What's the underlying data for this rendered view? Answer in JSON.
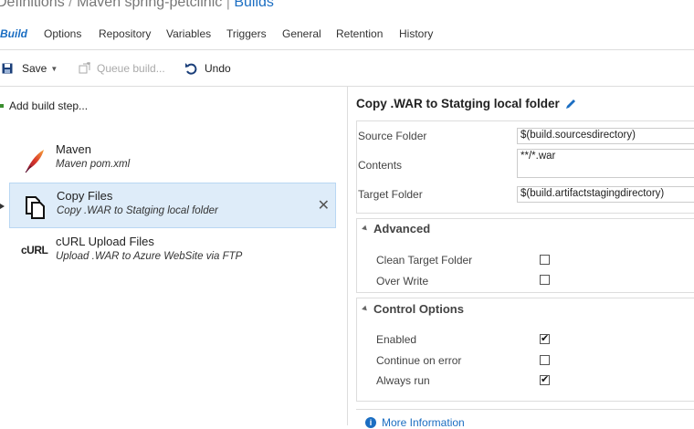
{
  "breadcrumb": {
    "part1": "Definitions",
    "sep1": "/",
    "part2": "Maven spring-petclinic",
    "sep2": "|",
    "current": "Builds"
  },
  "tabs": [
    "Build",
    "Options",
    "Repository",
    "Variables",
    "Triggers",
    "General",
    "Retention",
    "History"
  ],
  "active_tab": "Build",
  "toolbar": {
    "save_label": "Save",
    "queue_label": "Queue build...",
    "undo_label": "Undo"
  },
  "left": {
    "add_step_label": "Add build step...",
    "tasks": [
      {
        "name": "Maven",
        "description": "Maven pom.xml",
        "icon": "maven-feather-icon",
        "selected": false
      },
      {
        "name": "Copy Files",
        "description": "Copy .WAR to Statging local folder",
        "icon": "copy-files-icon",
        "selected": true
      },
      {
        "name": "cURL Upload Files",
        "description": "Upload .WAR to Azure WebSite via FTP",
        "icon": "curl-icon",
        "selected": false
      }
    ]
  },
  "detail": {
    "title": "Copy .WAR to Statging local folder",
    "fields": [
      {
        "label": "Source Folder",
        "value": "$(build.sourcesdirectory)"
      },
      {
        "label": "Contents",
        "value": "**/*.war"
      },
      {
        "label": "Target Folder",
        "value": "$(build.artifactstagingdirectory)"
      }
    ],
    "advanced": {
      "title": "Advanced",
      "options": [
        {
          "label": "Clean Target Folder",
          "checked": false
        },
        {
          "label": "Over Write",
          "checked": false
        }
      ]
    },
    "control": {
      "title": "Control Options",
      "options": [
        {
          "label": "Enabled",
          "checked": true
        },
        {
          "label": "Continue on error",
          "checked": false
        },
        {
          "label": "Always run",
          "checked": true
        }
      ]
    },
    "more_info": "More Information"
  },
  "colors": {
    "accent": "#1b6ec2",
    "selected_bg": "#deecf9",
    "border": "#dddddd"
  }
}
